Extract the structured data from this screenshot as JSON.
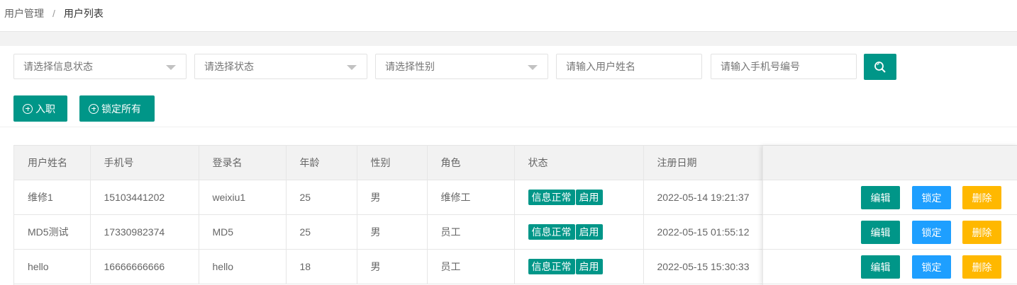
{
  "breadcrumb": {
    "parent": "用户管理",
    "separator": "/",
    "current": "用户列表"
  },
  "filters": {
    "info_status_placeholder": "请选择信息状态",
    "status_placeholder": "请选择状态",
    "gender_placeholder": "请选择性别",
    "username_placeholder": "请输入用户姓名",
    "phone_placeholder": "请输入手机号编号"
  },
  "toolbar": {
    "onboard_label": "入职",
    "lock_all_label": "锁定所有"
  },
  "table": {
    "headers": [
      "用户姓名",
      "手机号",
      "登录名",
      "年龄",
      "性别",
      "角色",
      "状态",
      "注册日期"
    ],
    "rows": [
      {
        "name": "维修1",
        "phone": "15103441202",
        "login": "weixiu1",
        "age": "25",
        "gender": "男",
        "role": "维修工",
        "info_status": "信息正常",
        "status": "启用",
        "date": "2022-05-14 19:21:37"
      },
      {
        "name": "MD5测试",
        "phone": "17330982374",
        "login": "MD5",
        "age": "25",
        "gender": "男",
        "role": "员工",
        "info_status": "信息正常",
        "status": "启用",
        "date": "2022-05-15 01:55:12"
      },
      {
        "name": "hello",
        "phone": "16666666666",
        "login": "hello",
        "age": "18",
        "gender": "男",
        "role": "员工",
        "info_status": "信息正常",
        "status": "启用",
        "date": "2022-05-15 15:30:33"
      }
    ],
    "actions": {
      "edit": "编辑",
      "lock": "锁定",
      "delete": "删除"
    }
  },
  "colors": {
    "primary": "#009688",
    "blue": "#1e9fff",
    "warn": "#ffb800"
  }
}
